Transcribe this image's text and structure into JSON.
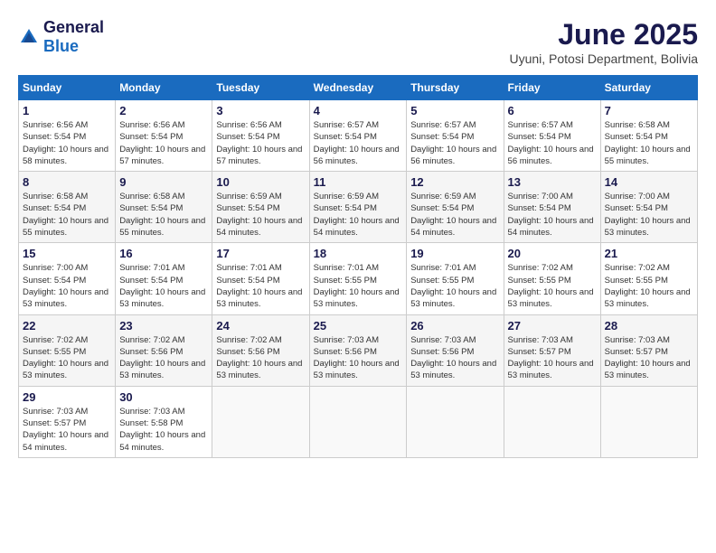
{
  "header": {
    "logo_general": "General",
    "logo_blue": "Blue",
    "month_title": "June 2025",
    "location": "Uyuni, Potosi Department, Bolivia"
  },
  "calendar": {
    "days_of_week": [
      "Sunday",
      "Monday",
      "Tuesday",
      "Wednesday",
      "Thursday",
      "Friday",
      "Saturday"
    ],
    "weeks": [
      [
        null,
        {
          "day": "2",
          "sunrise": "6:56 AM",
          "sunset": "5:54 PM",
          "daylight": "10 hours and 57 minutes."
        },
        {
          "day": "3",
          "sunrise": "6:56 AM",
          "sunset": "5:54 PM",
          "daylight": "10 hours and 57 minutes."
        },
        {
          "day": "4",
          "sunrise": "6:57 AM",
          "sunset": "5:54 PM",
          "daylight": "10 hours and 56 minutes."
        },
        {
          "day": "5",
          "sunrise": "6:57 AM",
          "sunset": "5:54 PM",
          "daylight": "10 hours and 56 minutes."
        },
        {
          "day": "6",
          "sunrise": "6:57 AM",
          "sunset": "5:54 PM",
          "daylight": "10 hours and 56 minutes."
        },
        {
          "day": "7",
          "sunrise": "6:58 AM",
          "sunset": "5:54 PM",
          "daylight": "10 hours and 55 minutes."
        }
      ],
      [
        {
          "day": "1",
          "sunrise": "6:56 AM",
          "sunset": "5:54 PM",
          "daylight": "10 hours and 58 minutes."
        },
        {
          "day": "8",
          "sunrise": "6:58 AM",
          "sunset": "5:54 PM",
          "daylight": "10 hours and 55 minutes."
        },
        {
          "day": "9",
          "sunrise": "6:58 AM",
          "sunset": "5:54 PM",
          "daylight": "10 hours and 55 minutes."
        },
        {
          "day": "10",
          "sunrise": "6:59 AM",
          "sunset": "5:54 PM",
          "daylight": "10 hours and 54 minutes."
        },
        {
          "day": "11",
          "sunrise": "6:59 AM",
          "sunset": "5:54 PM",
          "daylight": "10 hours and 54 minutes."
        },
        {
          "day": "12",
          "sunrise": "6:59 AM",
          "sunset": "5:54 PM",
          "daylight": "10 hours and 54 minutes."
        },
        {
          "day": "13",
          "sunrise": "7:00 AM",
          "sunset": "5:54 PM",
          "daylight": "10 hours and 54 minutes."
        },
        {
          "day": "14",
          "sunrise": "7:00 AM",
          "sunset": "5:54 PM",
          "daylight": "10 hours and 53 minutes."
        }
      ],
      [
        {
          "day": "15",
          "sunrise": "7:00 AM",
          "sunset": "5:54 PM",
          "daylight": "10 hours and 53 minutes."
        },
        {
          "day": "16",
          "sunrise": "7:01 AM",
          "sunset": "5:54 PM",
          "daylight": "10 hours and 53 minutes."
        },
        {
          "day": "17",
          "sunrise": "7:01 AM",
          "sunset": "5:54 PM",
          "daylight": "10 hours and 53 minutes."
        },
        {
          "day": "18",
          "sunrise": "7:01 AM",
          "sunset": "5:55 PM",
          "daylight": "10 hours and 53 minutes."
        },
        {
          "day": "19",
          "sunrise": "7:01 AM",
          "sunset": "5:55 PM",
          "daylight": "10 hours and 53 minutes."
        },
        {
          "day": "20",
          "sunrise": "7:02 AM",
          "sunset": "5:55 PM",
          "daylight": "10 hours and 53 minutes."
        },
        {
          "day": "21",
          "sunrise": "7:02 AM",
          "sunset": "5:55 PM",
          "daylight": "10 hours and 53 minutes."
        }
      ],
      [
        {
          "day": "22",
          "sunrise": "7:02 AM",
          "sunset": "5:55 PM",
          "daylight": "10 hours and 53 minutes."
        },
        {
          "day": "23",
          "sunrise": "7:02 AM",
          "sunset": "5:56 PM",
          "daylight": "10 hours and 53 minutes."
        },
        {
          "day": "24",
          "sunrise": "7:02 AM",
          "sunset": "5:56 PM",
          "daylight": "10 hours and 53 minutes."
        },
        {
          "day": "25",
          "sunrise": "7:03 AM",
          "sunset": "5:56 PM",
          "daylight": "10 hours and 53 minutes."
        },
        {
          "day": "26",
          "sunrise": "7:03 AM",
          "sunset": "5:56 PM",
          "daylight": "10 hours and 53 minutes."
        },
        {
          "day": "27",
          "sunrise": "7:03 AM",
          "sunset": "5:57 PM",
          "daylight": "10 hours and 53 minutes."
        },
        {
          "day": "28",
          "sunrise": "7:03 AM",
          "sunset": "5:57 PM",
          "daylight": "10 hours and 53 minutes."
        }
      ],
      [
        {
          "day": "29",
          "sunrise": "7:03 AM",
          "sunset": "5:57 PM",
          "daylight": "10 hours and 54 minutes."
        },
        {
          "day": "30",
          "sunrise": "7:03 AM",
          "sunset": "5:58 PM",
          "daylight": "10 hours and 54 minutes."
        },
        null,
        null,
        null,
        null,
        null
      ]
    ]
  }
}
